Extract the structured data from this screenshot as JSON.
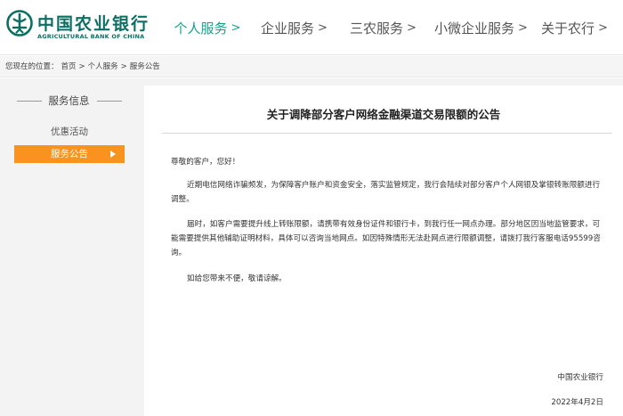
{
  "header": {
    "logo_cn": "中国农业银行",
    "logo_en": "AGRICULTURAL BANK OF CHINA",
    "nav": [
      {
        "label": "个人服务",
        "chevron": ">",
        "active": true
      },
      {
        "label": "企业服务",
        "chevron": ">",
        "active": false
      },
      {
        "label": "三农服务",
        "chevron": ">",
        "active": false
      },
      {
        "label": "小微企业服务",
        "chevron": ">",
        "active": false
      },
      {
        "label": "关于农行",
        "chevron": ">",
        "active": false
      }
    ]
  },
  "breadcrumb": {
    "prefix": "您现在的位置：",
    "items": [
      "首页",
      "个人服务",
      "服务公告"
    ],
    "separator": ">"
  },
  "sidebar": {
    "title": "服务信息",
    "items": [
      {
        "label": "优惠活动",
        "active": false
      },
      {
        "label": "服务公告",
        "active": true
      }
    ]
  },
  "article": {
    "title": "关于调降部分客户网络金融渠道交易限额的公告",
    "greeting": "尊敬的客户，您好！",
    "paragraphs": [
      "近期电信网络诈骗频发，为保障客户账户和资金安全，落实监管规定，我行会陆续对部分客户个人网银及掌银转账限额进行调整。",
      "届时，如客户需要提升线上转账限额，请携带有效身份证件和银行卡，到我行任一网点办理。部分地区因当地监管要求，可能需要提供其他辅助证明材料，具体可以咨询当地网点。如因特殊情形无法赴网点进行限额调整，请拨打我行客服电话95599咨询。",
      "如给您带来不便，敬请谅解。"
    ],
    "signature": "中国农业银行",
    "date": "2022年4月2日"
  },
  "colors": {
    "brand_green": "#0d6f63",
    "nav_active": "#14a38b",
    "sidebar_active": "#f7931e"
  }
}
